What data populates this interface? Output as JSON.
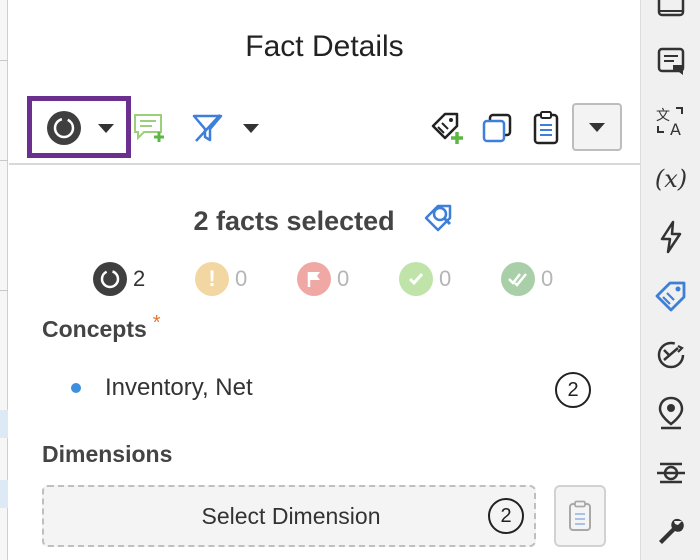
{
  "panel": {
    "title": "Fact Details"
  },
  "toolbar": {
    "icons": [
      "status-dropdown-icon",
      "add-comment-icon",
      "filter-icon",
      "add-tag-icon",
      "copy-icon",
      "clipboard-icon",
      "more-dropdown-icon"
    ]
  },
  "selection": {
    "text": "2 facts selected",
    "icon": "search-tag-icon"
  },
  "status_counts": [
    {
      "name": "in-progress",
      "count": "2",
      "color": "#3f3f3f"
    },
    {
      "name": "warning",
      "count": "0",
      "color": "#f3d7a2"
    },
    {
      "name": "flagged",
      "count": "0",
      "color": "#efa8a4"
    },
    {
      "name": "approved",
      "count": "0",
      "color": "#bfe3a9"
    },
    {
      "name": "reviewed",
      "count": "0",
      "color": "#a9cfa9"
    }
  ],
  "concepts": {
    "heading": "Concepts",
    "required_mark": "*",
    "items": [
      {
        "label": "Inventory, Net",
        "count": "2"
      }
    ]
  },
  "dimensions": {
    "heading": "Dimensions",
    "select_label": "Select Dimension",
    "count": "2"
  },
  "right_rail": {
    "icons": [
      "tab-icon",
      "comment-icon",
      "translate-icon",
      "formula-icon",
      "lightning-icon",
      "tag-icon",
      "shuffle-icon",
      "location-pin-icon",
      "connector-icon",
      "wrench-icon"
    ],
    "formula_text": "(x)",
    "active_color": "#3d7fd9"
  }
}
